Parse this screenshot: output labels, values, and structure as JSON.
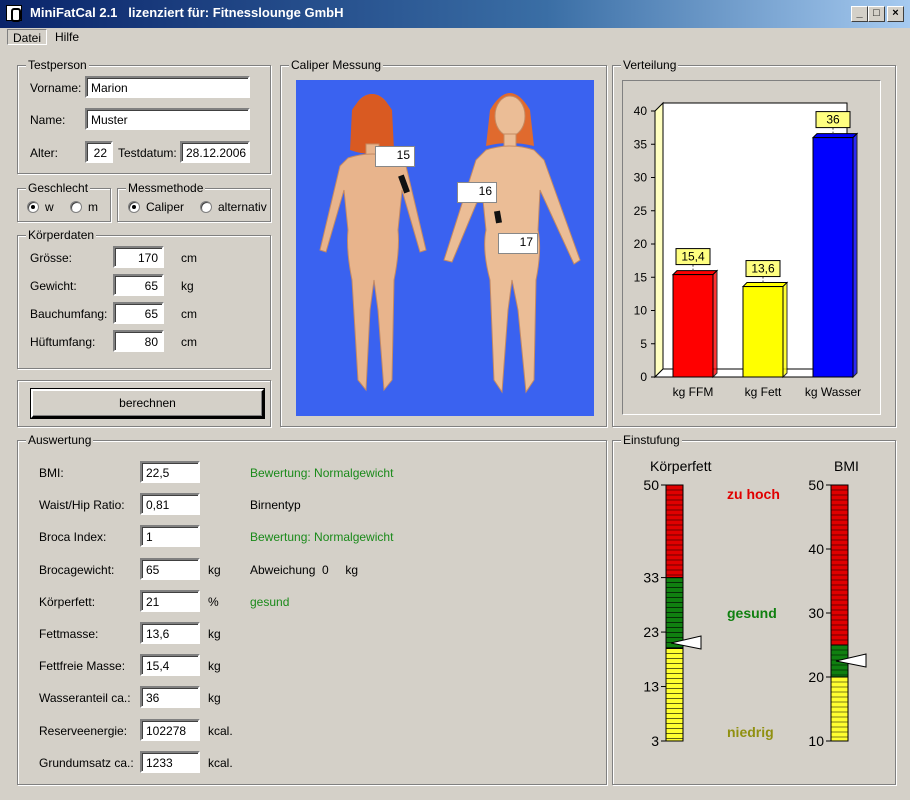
{
  "window": {
    "title": "MiniFatCal 2.1   lizenziert für: Fitnesslounge GmbH"
  },
  "menu": [
    "Datei",
    "Hilfe"
  ],
  "testperson": {
    "legend": "Testperson",
    "vorname_label": "Vorname:",
    "vorname": "Marion",
    "name_label": "Name:",
    "name": "Muster",
    "alter_label": "Alter:",
    "alter": "22",
    "testdatum_label": "Testdatum:",
    "testdatum": "28.12.2006"
  },
  "geschlecht": {
    "legend": "Geschlecht",
    "w": "w",
    "m": "m",
    "selected": "w"
  },
  "messmethode": {
    "legend": "Messmethode",
    "caliper": "Caliper",
    "alternativ": "alternativ",
    "selected": "Caliper"
  },
  "koerperdaten": {
    "legend": "Körperdaten",
    "rows": [
      {
        "label": "Grösse:",
        "value": "170",
        "unit": "cm"
      },
      {
        "label": "Gewicht:",
        "value": "65",
        "unit": "kg"
      },
      {
        "label": "Bauchumfang:",
        "value": "65",
        "unit": "cm"
      },
      {
        "label": "Hüftumfang:",
        "value": "80",
        "unit": "cm"
      }
    ]
  },
  "berechnen_label": "berechnen",
  "caliper": {
    "legend": "Caliper Messung",
    "points": [
      "15",
      "16",
      "17"
    ]
  },
  "verteilung": {
    "legend": "Verteilung"
  },
  "chart_data": {
    "type": "bar",
    "categories": [
      "kg FFM",
      "kg Fett",
      "kg Wasser"
    ],
    "values": [
      15.4,
      13.6,
      36
    ],
    "value_labels": [
      "15,4",
      "13,6",
      "36"
    ],
    "colors": [
      "#ff0000",
      "#ffff00",
      "#0000ff"
    ],
    "yticks": [
      "0",
      "5",
      "10",
      "15",
      "20",
      "25",
      "30",
      "35",
      "40"
    ],
    "ylim": [
      0,
      40
    ],
    "grid": false,
    "title": "",
    "xlabel": "",
    "ylabel": ""
  },
  "auswertung": {
    "legend": "Auswertung",
    "rows": [
      {
        "label": "BMI:",
        "value": "22,5",
        "unit": "",
        "note": "Bewertung: Normalgewicht",
        "note_color": "green"
      },
      {
        "label": "Waist/Hip Ratio:",
        "value": "0,81",
        "unit": "",
        "note": "Birnentyp",
        "note_color": "black"
      },
      {
        "label": "Broca Index:",
        "value": "1",
        "unit": "",
        "note": "Bewertung: Normalgewicht",
        "note_color": "green"
      },
      {
        "label": "Brocagewicht:",
        "value": "65",
        "unit": "kg",
        "note": "Abweichung  0     kg",
        "note_color": "black"
      },
      {
        "label": "Körperfett:",
        "value": "21",
        "unit": "%",
        "note": "gesund",
        "note_color": "green"
      },
      {
        "label": "Fettmasse:",
        "value": "13,6",
        "unit": "kg",
        "note": "",
        "note_color": "black"
      },
      {
        "label": "Fettfreie Masse:",
        "value": "15,4",
        "unit": "kg",
        "note": "",
        "note_color": "black"
      },
      {
        "label": "Wasseranteil ca.:",
        "value": "36",
        "unit": "kg",
        "note": "",
        "note_color": "black"
      },
      {
        "label": "Reserveenergie:",
        "value": "102278",
        "unit": "kcal.",
        "note": "",
        "note_color": "black"
      },
      {
        "label": "Grundumsatz ca.:",
        "value": "1233",
        "unit": "kcal.",
        "note": "",
        "note_color": "black"
      }
    ]
  },
  "einstufung": {
    "legend": "Einstufung",
    "koerperfett": {
      "title": "Körperfett",
      "ticks": [
        "50",
        "33",
        "23",
        "13",
        "3"
      ],
      "marker_value": 21
    },
    "bmi": {
      "title": "BMI",
      "ticks": [
        "50",
        "40",
        "30",
        "20",
        "10"
      ],
      "marker_value": 22.5
    },
    "zones": {
      "high": "zu hoch",
      "ok": "gesund",
      "low": "niedrig"
    },
    "colors": {
      "high": "#e00000",
      "ok": "#108010",
      "low": "#ffff30"
    }
  }
}
